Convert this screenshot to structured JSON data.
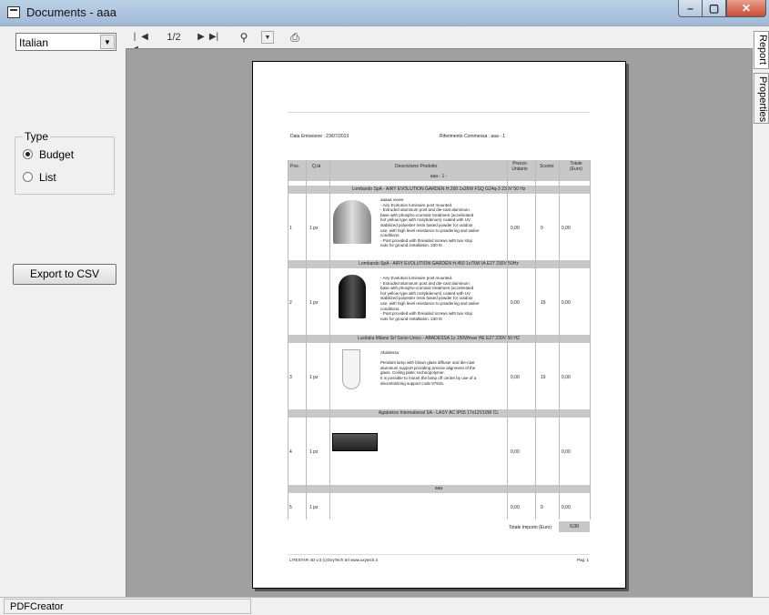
{
  "window": {
    "title": "Documents - aaa"
  },
  "left": {
    "language": "Italian",
    "type_label": "Type",
    "radios": [
      {
        "label": "Budget",
        "selected": true
      },
      {
        "label": "List",
        "selected": false
      }
    ],
    "export_label": "Export to CSV"
  },
  "toolbar": {
    "page_indicator": "1/2",
    "zoom_icon": "magnifier-icon",
    "print_icon": "printer-icon"
  },
  "sidetabs": {
    "report": "Report",
    "properties": "Properties"
  },
  "status": {
    "text": "PDFCreator"
  },
  "report": {
    "date_label": "Data Emissione : 23/07/2013",
    "ref_label": "Riferimento Commessa : aaa - 1",
    "headers": {
      "pos": "Pos.",
      "qty": "Q.tà",
      "desc": "Descrizione Prodotto",
      "price": "Prezzo Unitario",
      "discount": "Sconto",
      "total": "Totale (Euro)"
    },
    "group": "aaa - 1 -",
    "items": [
      {
        "band": "Lombardo SpA - AIRY EVOLUTION GARDEN H.200 1x26W FSQ G24q-3 230V 50 Hz",
        "pos": "1",
        "qty": "1 pz",
        "price": "0,00",
        "discount": "0",
        "total": "0,00",
        "desc": "aaaaa vvvee\n- Airy Evolution luminaire post mounted.\n- Extruded aluminum post and die-cast aluminum\nbase with phospho-cromatic treatment (accelerated\nhot yellow type with molybdenum) coated with UV\nstabilized polyester resin based powder for outdoor\nuse, with high level resistance to powdering and saline\nconditions.\n- Post provided with threaded screws with two stop\nnuts for ground installation. 230 I5"
      },
      {
        "band": "Lombardo SpA - AIRY EVOLUTION GARDEN H.450 1x75W IA E27 230V 50Hz",
        "pos": "2",
        "qty": "1 pz",
        "price": "0,00",
        "discount": "15",
        "total": "0,00",
        "desc": "- Airy Evolution luminaire post mounted.\n- Extruded aluminum post and die-cast aluminum\nbase with phospho-cromatic treatment (accelerated\nhot yellow type with molybdenum) coated with UV\nstabilized polyester resin based powder for outdoor\nuse, with high level resistance to powdering and saline\nconditions.\n- Post provided with threaded screws with two stop\nnuts for ground installation. 230 I5"
      },
      {
        "band": "Lucitalia Milano Srl Socio Unico - ABADESSA 1x 150Wmax HE E27 230V 50 HZ",
        "pos": "3",
        "qty": "1 pz",
        "price": "0,00",
        "discount": "15",
        "total": "0,00",
        "desc": "Abadessa\n\nPendant lamp with blown glass diffuser and die-cast\naluminum support providing precise alignment of the\nglass. Ceiling plate: technopolymer.\nIt is possible to mount the lamp off centre by use of a\ndecentralizing support code 57915."
      },
      {
        "band": "Agabekov International SA - LASY AC IP65 17x12V10W CL",
        "pos": "4",
        "qty": "1 pz",
        "price": "0,00",
        "discount": "",
        "total": "0,00",
        "desc": ""
      },
      {
        "band": "aaa",
        "pos": "5",
        "qty": "1 pz",
        "price": "0,00",
        "discount": "0",
        "total": "0,00",
        "desc": ""
      }
    ],
    "total_label": "Totale Importo (Euro)",
    "total_value": "0,00",
    "footer_left": "LITESTAR 4D v.3    (c)OxyTech Srl   www.oxytech.it",
    "footer_right": "Pag. 1"
  }
}
